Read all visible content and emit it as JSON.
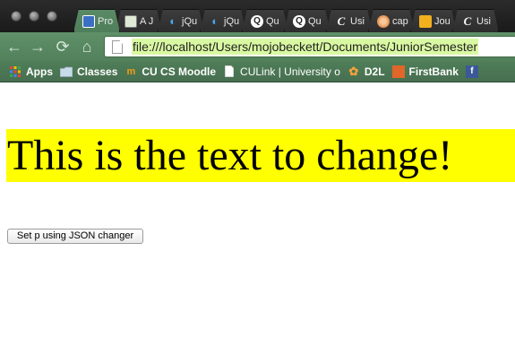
{
  "browser": {
    "tabs": [
      {
        "title": "Pro",
        "favicon": "page-grid-icon",
        "active": true
      },
      {
        "title": "A J",
        "favicon": "image-icon",
        "active": false
      },
      {
        "title": "jQu",
        "favicon": "jquery-icon",
        "active": false
      },
      {
        "title": "jQu",
        "favicon": "jquery-icon",
        "active": false
      },
      {
        "title": "Qu",
        "favicon": "circle-q-icon",
        "active": false
      },
      {
        "title": "Qu",
        "favicon": "circle-q-icon",
        "active": false
      },
      {
        "title": "Usi",
        "favicon": "script-c-icon",
        "active": false
      },
      {
        "title": "cap",
        "favicon": "orange-flower-icon",
        "active": false
      },
      {
        "title": "Jou",
        "favicon": "yellow-box-icon",
        "active": false
      },
      {
        "title": "Usi",
        "favicon": "script-c-icon",
        "active": false
      }
    ],
    "url": "file:///localhost/Users/mojobeckett/Documents/JuniorSemester",
    "bookmarks": [
      {
        "label": "Apps",
        "icon": "apps-grid-icon"
      },
      {
        "label": "Classes",
        "icon": "folder-icon"
      },
      {
        "label": "CU CS Moodle",
        "icon": "moodle-icon"
      },
      {
        "label": "CULink | University o",
        "icon": "page-icon"
      },
      {
        "label": "D2L",
        "icon": "d2l-flower-icon"
      },
      {
        "label": "FirstBank",
        "icon": "firstbank-icon"
      },
      {
        "label": "f",
        "icon": "facebook-icon"
      }
    ]
  },
  "page": {
    "paragraph_text": "This is the text to change!",
    "button_label": "Set p using JSON changer"
  },
  "colors": {
    "highlight": "#ffff00",
    "theme_green": "#52815b"
  }
}
